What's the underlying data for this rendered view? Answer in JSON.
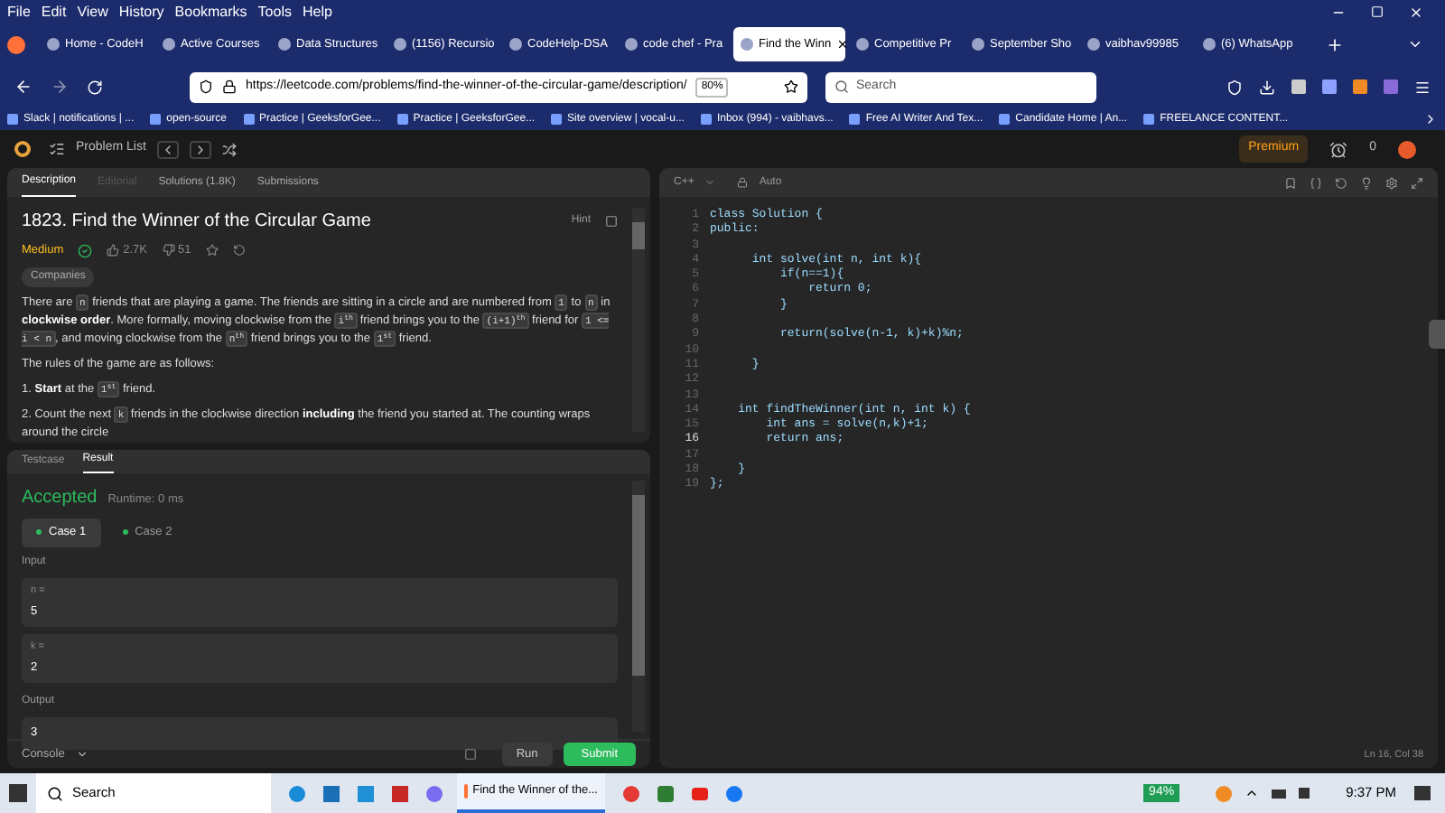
{
  "menu": [
    "File",
    "Edit",
    "View",
    "History",
    "Bookmarks",
    "Tools",
    "Help"
  ],
  "tabs": [
    {
      "label": "Home - CodeH",
      "selected": false
    },
    {
      "label": "Active Courses",
      "selected": false
    },
    {
      "label": "Data Structures",
      "selected": false
    },
    {
      "label": "(1156) Recursio",
      "selected": false
    },
    {
      "label": "CodeHelp-DSA",
      "selected": false
    },
    {
      "label": "code chef - Pra",
      "selected": false
    },
    {
      "label": "Find the Winn",
      "selected": true
    },
    {
      "label": "Competitive Pr",
      "selected": false
    },
    {
      "label": "September Sho",
      "selected": false
    },
    {
      "label": "vaibhav99985",
      "selected": false
    },
    {
      "label": "(6) WhatsApp",
      "selected": false
    }
  ],
  "address": {
    "url": "https://leetcode.com/problems/find-the-winner-of-the-circular-game/description/",
    "zoom": "80%"
  },
  "search": {
    "placeholder": "Search"
  },
  "bookmarks": [
    "Slack | notifications | ...",
    "open-source",
    "Practice | GeeksforGee...",
    "Practice | GeeksforGee...",
    "Site overview | vocal-u...",
    "Inbox (994) - vaibhavs...",
    "Free AI Writer And Tex...",
    "Candidate Home | An...",
    "FREELANCE CONTENT..."
  ],
  "lc_header": {
    "problem_list": "Problem List",
    "premium": "Premium",
    "streak": "0"
  },
  "description": {
    "tabs": [
      {
        "label": "Description",
        "selected": true,
        "disabled": false
      },
      {
        "label": "Editorial",
        "selected": false,
        "disabled": true
      },
      {
        "label": "Solutions (1.8K)",
        "selected": false,
        "disabled": false
      },
      {
        "label": "Submissions",
        "selected": false,
        "disabled": false
      }
    ],
    "title": "1823. Find the Winner of the Circular Game",
    "hint": "Hint",
    "difficulty": "Medium",
    "likes": "2.7K",
    "dislikes": "51",
    "companies": "Companies",
    "paragraphs": [
      [
        {
          "kind": "text",
          "text": "There are "
        },
        {
          "kind": "code",
          "text": "n"
        },
        {
          "kind": "text",
          "text": " friends that are playing a game. The friends are sitting in a circle and are numbered from "
        },
        {
          "kind": "code",
          "text": "1"
        },
        {
          "kind": "text",
          "text": " to "
        },
        {
          "kind": "code",
          "text": "n"
        },
        {
          "kind": "text",
          "text": " in "
        },
        {
          "kind": "bold",
          "text": "clockwise order"
        },
        {
          "kind": "text",
          "text": ". More formally, moving clockwise from the "
        },
        {
          "kind": "code",
          "text": "i$^{th}$"
        },
        {
          "kind": "text",
          "text": " friend brings you to the "
        },
        {
          "kind": "code",
          "text": "(i+1)$^{th}$"
        },
        {
          "kind": "text",
          "text": " friend for "
        },
        {
          "kind": "code",
          "text": "1 <= i < n"
        },
        {
          "kind": "text",
          "text": ", and moving clockwise from the "
        },
        {
          "kind": "code",
          "text": "n$^{th}$"
        },
        {
          "kind": "text",
          "text": " friend brings you to the "
        },
        {
          "kind": "code",
          "text": "1$^{st}$"
        },
        {
          "kind": "text",
          "text": " friend."
        }
      ],
      [
        {
          "kind": "text",
          "text": "The rules of the game are as follows:"
        }
      ],
      [
        {
          "kind": "text",
          "text": "1. "
        },
        {
          "kind": "bold",
          "text": "Start"
        },
        {
          "kind": "text",
          "text": " at the "
        },
        {
          "kind": "code",
          "text": "1$^{st}$"
        },
        {
          "kind": "text",
          "text": " friend."
        }
      ],
      [
        {
          "kind": "text",
          "text": "2. Count the next "
        },
        {
          "kind": "code",
          "text": "k"
        },
        {
          "kind": "text",
          "text": " friends in the clockwise direction "
        },
        {
          "kind": "bold",
          "text": "including"
        },
        {
          "kind": "text",
          "text": " the friend you started at. The counting wraps around the circle"
        }
      ]
    ]
  },
  "result_panel": {
    "tabs": [
      {
        "label": "Testcase",
        "selected": false
      },
      {
        "label": "Result",
        "selected": true
      }
    ],
    "status": "Accepted",
    "runtime": "Runtime: 0 ms",
    "cases": [
      {
        "label": "Case 1",
        "selected": true
      },
      {
        "label": "Case 2",
        "selected": false
      }
    ],
    "input_label": "Input",
    "inputs": [
      {
        "name": "n =",
        "value": "5"
      },
      {
        "name": "k =",
        "value": "2"
      }
    ],
    "output_label": "Output",
    "output": "3",
    "console": "Console",
    "run": "Run",
    "submit": "Submit"
  },
  "editor": {
    "language": "C++",
    "mode": "Auto",
    "status": "Ln 16, Col 38",
    "lines": [
      {
        "num": "1",
        "code": "class Solution {",
        "current": false
      },
      {
        "num": "2",
        "code": "public:",
        "current": false
      },
      {
        "num": "3",
        "current": false
      },
      {
        "num": "4",
        "code": "      int solve(int n, int k){",
        "current": false
      },
      {
        "num": "5",
        "code": "          if(n==1){",
        "current": false
      },
      {
        "num": "6",
        "code": "              return 0;",
        "current": false
      },
      {
        "num": "7",
        "code": "          }",
        "current": false
      },
      {
        "num": "8",
        "current": false
      },
      {
        "num": "9",
        "code": "          return(solve(n-1, k)+k)%n;",
        "current": false
      },
      {
        "num": "10",
        "current": false
      },
      {
        "num": "11",
        "code": "      }",
        "current": false
      },
      {
        "num": "12",
        "current": false
      },
      {
        "num": "13",
        "current": false
      },
      {
        "num": "14",
        "code": "    int findTheWinner(int n, int k) {",
        "current": false
      },
      {
        "num": "15",
        "code": "        int ans = solve(n,k)+1;",
        "current": false
      },
      {
        "num": "16",
        "code": "        return ans;",
        "current": true
      },
      {
        "num": "17",
        "current": false
      },
      {
        "num": "18",
        "code": "    }",
        "current": false
      },
      {
        "num": "19",
        "code": "};",
        "current": false
      }
    ]
  },
  "taskbar": {
    "search": "Search",
    "active_app": "Find the Winner of the...",
    "battery": "94%",
    "time": "9:37 PM"
  }
}
